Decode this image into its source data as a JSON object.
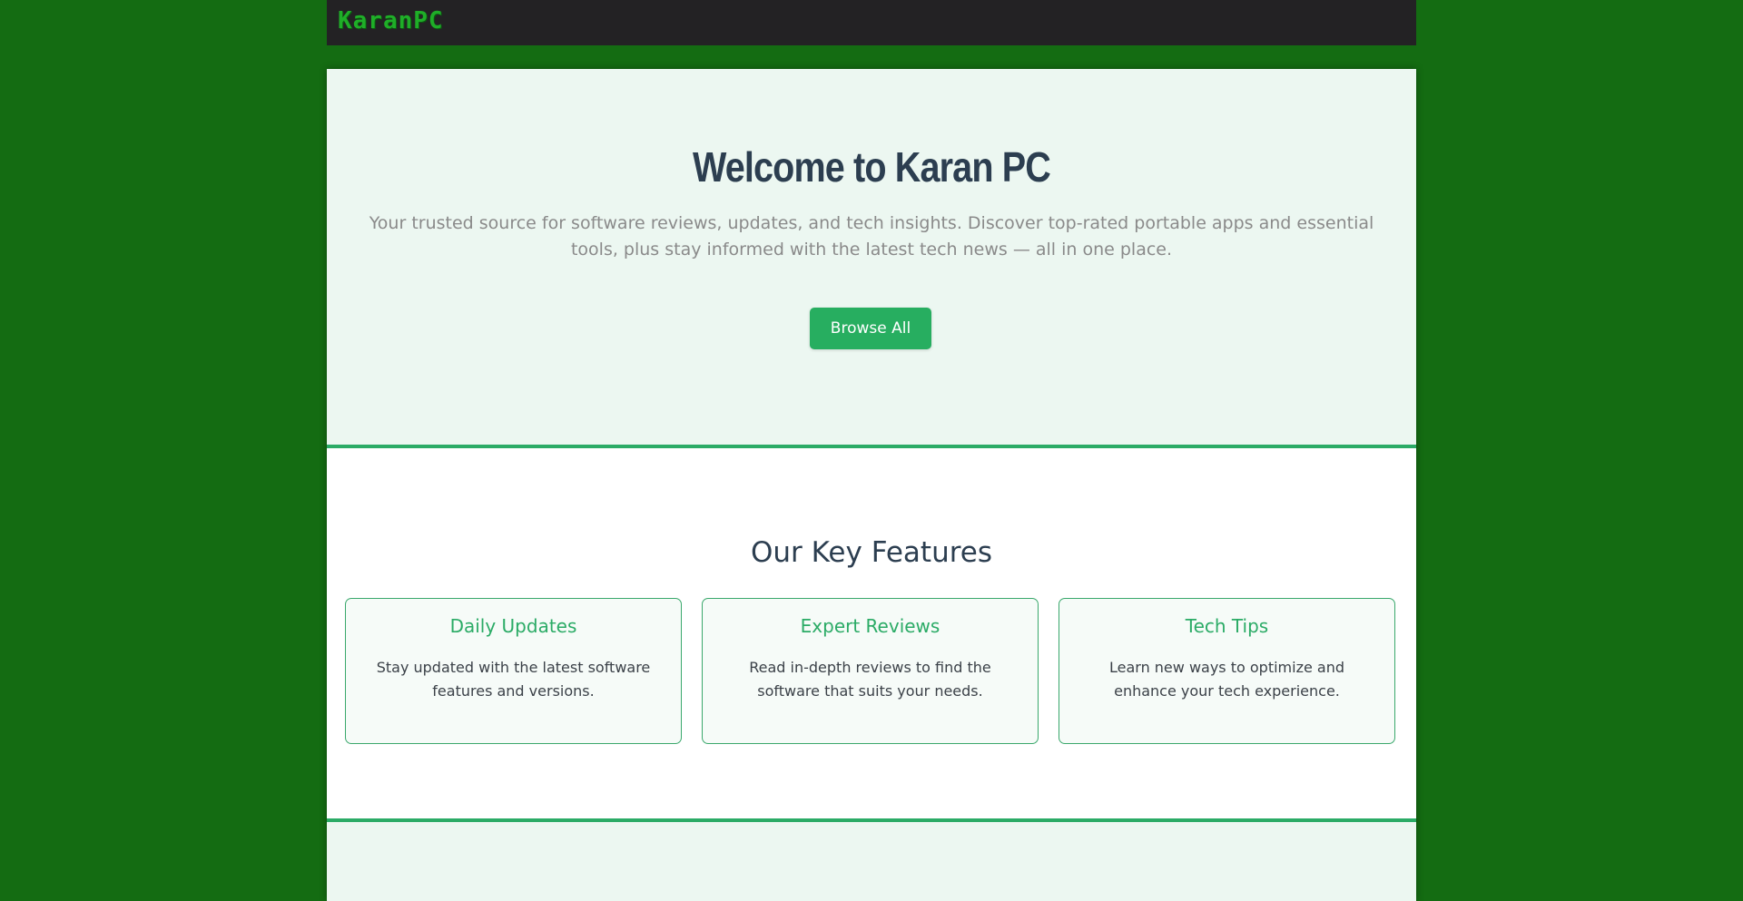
{
  "navbar": {
    "logo_text": "KaranPC"
  },
  "hero": {
    "title": "Welcome to Karan PC",
    "subtitle": "Your trusted source for software reviews, updates, and tech insights. Discover top-rated portable apps and essential tools, plus stay informed with the latest tech news — all in one place.",
    "browse_label": "Browse All"
  },
  "features": {
    "title": "Our Key Features",
    "cards": [
      {
        "title": "Daily Updates",
        "text": "Stay updated with the latest software features and versions."
      },
      {
        "title": "Expert Reviews",
        "text": "Read in-depth reviews to find the software that suits your needs."
      },
      {
        "title": "Tech Tips",
        "text": "Learn new ways to optimize and enhance your tech experience."
      }
    ]
  },
  "colors": {
    "page_background": "#146c12",
    "navbar": "#232224",
    "accent": "#27ae60",
    "heading": "#2c3e50"
  }
}
